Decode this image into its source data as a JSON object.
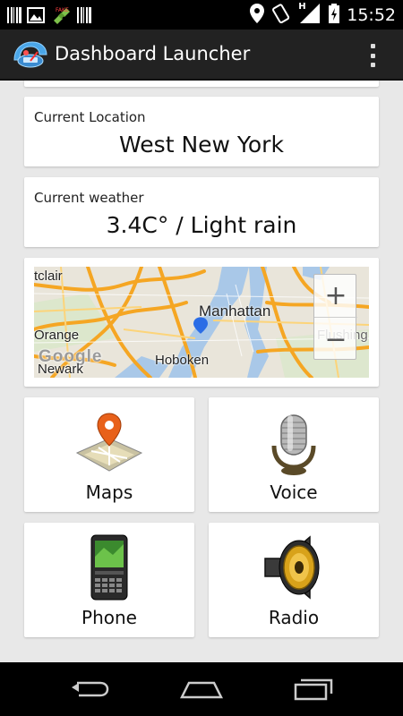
{
  "status_bar": {
    "time": "15:52",
    "left_icons": [
      "barcode-icon",
      "image-icon",
      "satellite-icon",
      "barcode-icon"
    ],
    "right_icons": [
      "location-pin-icon",
      "screen-rotate-icon",
      "signal-icon",
      "battery-icon"
    ],
    "network_type": "H"
  },
  "action_bar": {
    "title": "Dashboard Launcher",
    "app_icon": "dashboard-icon",
    "menu_icon": "overflow-menu-icon"
  },
  "location_card": {
    "label": "Current Location",
    "value": "West New York"
  },
  "weather_card": {
    "label": "Current weather",
    "value": "3.4C° / Light rain"
  },
  "map": {
    "labels": {
      "clair": "tclair",
      "manhattan": "Manhattan",
      "orange": "Orange",
      "flushing": "Flushing",
      "hoboken": "Hoboken",
      "newark": "Newark",
      "google": "Google"
    },
    "zoom_in": "+",
    "zoom_out": "−"
  },
  "tiles": [
    {
      "label": "Maps",
      "icon": "map-icon"
    },
    {
      "label": "Voice",
      "icon": "microphone-icon"
    },
    {
      "label": "Phone",
      "icon": "smartphone-icon"
    },
    {
      "label": "Radio",
      "icon": "speaker-icon"
    }
  ],
  "nav_bar": {
    "back_icon": "back-icon",
    "home_icon": "home-icon",
    "recents_icon": "recent-apps-icon"
  },
  "colors": {
    "action_bar": "#222222",
    "background": "#e8e8e8",
    "map_road": "#f5a623",
    "map_water": "#a9c8e8"
  }
}
